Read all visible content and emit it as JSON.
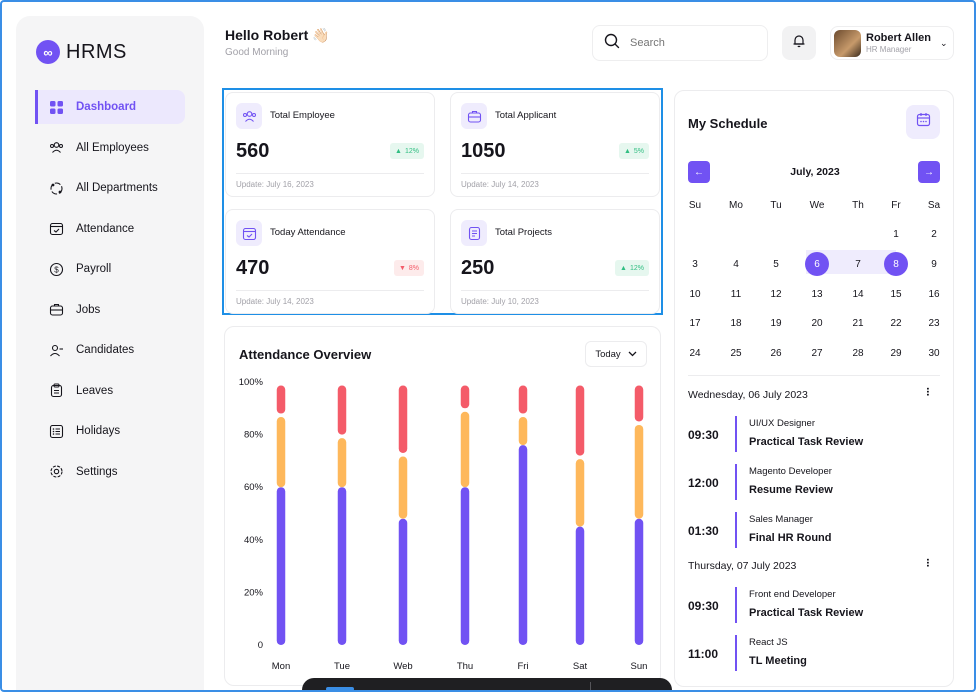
{
  "sidebar": {
    "logo_text": "HRMS",
    "items": [
      {
        "label": "Dashboard",
        "icon": "grid-icon",
        "active": true
      },
      {
        "label": "All Employees",
        "icon": "users-icon"
      },
      {
        "label": "All Departments",
        "icon": "departments-icon"
      },
      {
        "label": "Attendance",
        "icon": "calendar-check-icon"
      },
      {
        "label": "Payroll",
        "icon": "dollar-icon"
      },
      {
        "label": "Jobs",
        "icon": "briefcase-icon"
      },
      {
        "label": "Candidates",
        "icon": "candidates-icon"
      },
      {
        "label": "Leaves",
        "icon": "clipboard-icon"
      },
      {
        "label": "Holidays",
        "icon": "list-icon"
      },
      {
        "label": "Settings",
        "icon": "gear-icon"
      }
    ]
  },
  "header": {
    "title": "Hello Robert 👋🏻",
    "subtitle": "Good Morning",
    "search_placeholder": "Search",
    "user_name": "Robert Allen",
    "user_role": "HR Manager"
  },
  "stats": [
    {
      "label": "Total Employee",
      "value": "560",
      "change": "12%",
      "trend": "up",
      "update": "Update: July 16, 2023",
      "icon": "users-icon"
    },
    {
      "label": "Total Applicant",
      "value": "1050",
      "change": "5%",
      "trend": "up",
      "update": "Update: July 14, 2023",
      "icon": "briefcase-icon"
    },
    {
      "label": "Today Attendance",
      "value": "470",
      "change": "8%",
      "trend": "down",
      "update": "Update: July 14, 2023",
      "icon": "calendar-check-icon"
    },
    {
      "label": "Total Projects",
      "value": "250",
      "change": "12%",
      "trend": "up",
      "update": "Update: July 10, 2023",
      "icon": "document-icon"
    }
  ],
  "attendance": {
    "title": "Attendance Overview",
    "filter": "Today"
  },
  "chart_data": {
    "type": "bar",
    "title": "Attendance Overview",
    "categories": [
      "Mon",
      "Tue",
      "Web",
      "Thu",
      "Fri",
      "Sat",
      "Sun"
    ],
    "ytick_labels": [
      "100%",
      "80%",
      "60%",
      "40%",
      "20%",
      "0"
    ],
    "ylim": [
      0,
      100
    ],
    "stacked": true,
    "series": [
      {
        "color": "#7152F3",
        "values": [
          60,
          60,
          48,
          60,
          76,
          45,
          48
        ]
      },
      {
        "color": "#FEB85B",
        "values": [
          28,
          20,
          25,
          30,
          12,
          27,
          37
        ]
      },
      {
        "color": "#F45B69",
        "values": [
          12,
          20,
          27,
          10,
          12,
          28,
          15
        ]
      }
    ],
    "legend": "none",
    "grid": false
  },
  "schedule": {
    "title": "My Schedule",
    "month": "July, 2023",
    "weekdays": [
      "Su",
      "Mo",
      "Tu",
      "We",
      "Th",
      "Fr",
      "Sa"
    ],
    "weeks": [
      [
        "",
        "",
        "",
        "",
        "",
        "1",
        "2"
      ],
      [
        "3",
        "4",
        "5",
        "6",
        "7",
        "8",
        "9"
      ],
      [
        "10",
        "11",
        "12",
        "13",
        "14",
        "15",
        "16"
      ],
      [
        "17",
        "18",
        "19",
        "20",
        "21",
        "22",
        "23"
      ],
      [
        "24",
        "25",
        "26",
        "27",
        "28",
        "29",
        "30"
      ]
    ],
    "selected": [
      "6",
      "8"
    ],
    "in_range": [
      "7"
    ],
    "days": [
      {
        "heading": "Wednesday, 06 July 2023",
        "events": [
          {
            "time": "09:30",
            "role": "UI/UX Designer",
            "name": "Practical Task Review"
          },
          {
            "time": "12:00",
            "role": "Magento Developer",
            "name": "Resume Review"
          },
          {
            "time": "01:30",
            "role": "Sales Manager",
            "name": "Final HR Round"
          }
        ]
      },
      {
        "heading": "Thursday, 07 July 2023",
        "events": [
          {
            "time": "09:30",
            "role": "Front end Developer",
            "name": "Practical Task Review"
          },
          {
            "time": "11:00",
            "role": "React JS",
            "name": "TL Meeting"
          }
        ]
      }
    ]
  },
  "colors": {
    "accent": "#7152F3",
    "success": "#30BE82",
    "danger": "#F45B69",
    "warning": "#FEB85B"
  }
}
